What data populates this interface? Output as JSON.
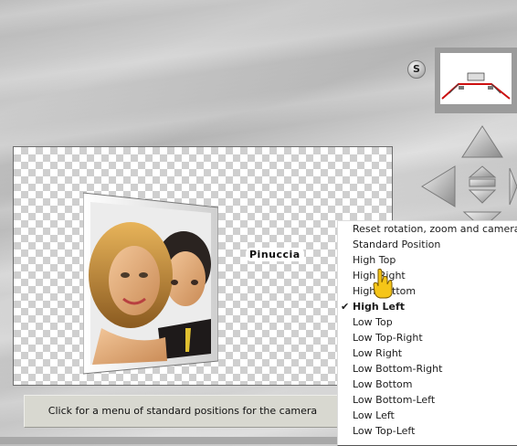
{
  "toolbar": {
    "s_button_label": "S"
  },
  "preview": {
    "thumbnail_icon": "camera-thumbnail-icon"
  },
  "canvas": {
    "watermark_text": "Pinuccia"
  },
  "status_bar": {
    "text": "Click for a menu of standard positions for the camera"
  },
  "menu": {
    "items": [
      {
        "label": "Reset rotation, zoom and camera",
        "checked": false,
        "bold": false
      },
      {
        "label": "Standard Position",
        "checked": false,
        "bold": false
      },
      {
        "label": "High Top",
        "checked": false,
        "bold": false
      },
      {
        "label": "High Right",
        "checked": false,
        "bold": false
      },
      {
        "label": "High Bottom",
        "checked": false,
        "bold": false
      },
      {
        "label": "High Left",
        "checked": true,
        "bold": true
      },
      {
        "label": "Low Top",
        "checked": false,
        "bold": false
      },
      {
        "label": "Low Top-Right",
        "checked": false,
        "bold": false
      },
      {
        "label": "Low Right",
        "checked": false,
        "bold": false
      },
      {
        "label": "Low Bottom-Right",
        "checked": false,
        "bold": false
      },
      {
        "label": "Low Bottom",
        "checked": false,
        "bold": false
      },
      {
        "label": "Low Bottom-Left",
        "checked": false,
        "bold": false
      },
      {
        "label": "Low Left",
        "checked": false,
        "bold": false
      },
      {
        "label": "Low Top-Left",
        "checked": false,
        "bold": false
      }
    ],
    "check_mark": "✔"
  },
  "colors": {
    "accent_red": "#cc1010",
    "arrow_gray": "#9a9a9a"
  }
}
